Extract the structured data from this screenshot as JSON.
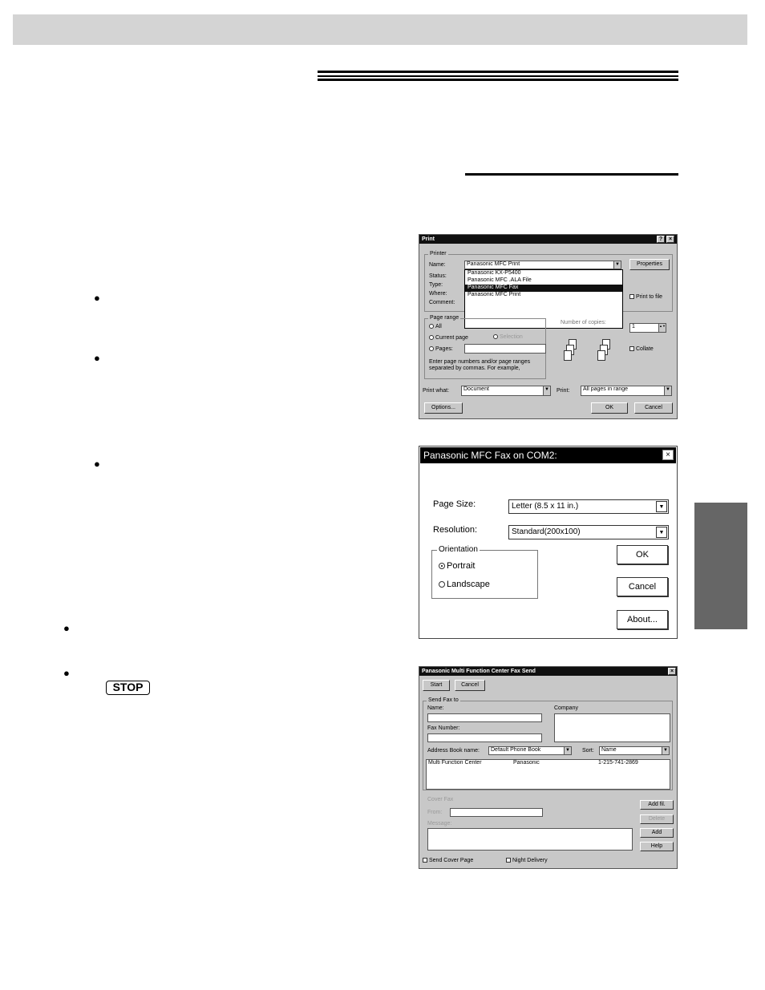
{
  "bullets": [
    "●",
    "●",
    "●",
    "●",
    "●"
  ],
  "stop_key": "STOP",
  "print_dialog": {
    "title": "Print",
    "help_btn": "?",
    "close_btn": "×",
    "printer_group": "Printer",
    "name_label": "Name:",
    "name_value": "Panasonic MFC Print",
    "status_label": "Status:",
    "type_label": "Type:",
    "where_label": "Where:",
    "comment_label": "Comment:",
    "printers": [
      "Panasonic KX-P5400",
      "Panasonic MFC .ALA File",
      "Panasonic MFC Fax",
      "Panasonic MFC Print"
    ],
    "properties_btn": "Properties",
    "print_to_file": "Print to file",
    "page_range_group": "Page range",
    "all_option": "All",
    "current_page": "Current page",
    "selection": "Selection",
    "pages_label": "Pages:",
    "pages_hint": "Enter page numbers and/or page ranges separated by commas. For example,",
    "copies_label": "Number of copies:",
    "copies_value": "1",
    "collate": "Collate",
    "print_what_label": "Print what:",
    "print_what_value": "Document",
    "print_label": "Print:",
    "print_value": "All pages in range",
    "options_btn": "Options...",
    "ok_btn": "OK",
    "cancel_btn": "Cancel",
    "arrow": "▼",
    "spin": "▲▼"
  },
  "setup_dialog": {
    "title": "Panasonic MFC Fax on COM2:",
    "close_btn": "×",
    "page_size_label": "Page Size:",
    "page_size_value": "Letter (8.5 x 11 in.)",
    "resolution_label": "Resolution:",
    "resolution_value": "Standard(200x100)",
    "orientation_group": "Orientation",
    "portrait": "Portrait",
    "landscape": "Landscape",
    "ok_btn": "OK",
    "cancel_btn": "Cancel",
    "about_btn": "About...",
    "arrow": "▼"
  },
  "send_dialog": {
    "title": "Panasonic Multi Function Center Fax Send",
    "close_btn": "×",
    "start_btn": "Start",
    "cancel_btn": "Cancel",
    "send_fax_to": "Send Fax to",
    "name_label": "Name:",
    "company_label": "Company",
    "fax_number_label": "Fax Number:",
    "address_book_label": "Address Book name:",
    "address_book_value": "Default Phone Book",
    "sort_label": "Sort:",
    "sort_value": "Name",
    "entry": {
      "name": "Multi Function Center",
      "company": "Panasonic",
      "number": "1-215-741-2869"
    },
    "cover_fax_group": "Cover Fax",
    "from_label": "From:",
    "message_label": "Message:",
    "addfl_btn": "Add fil.",
    "delete_btn": "Delete",
    "add_btn": "Add",
    "help_btn": "Help",
    "send_cover": "Send Cover Page",
    "night_delivery": "Night Delivery",
    "arrow": "▼"
  }
}
